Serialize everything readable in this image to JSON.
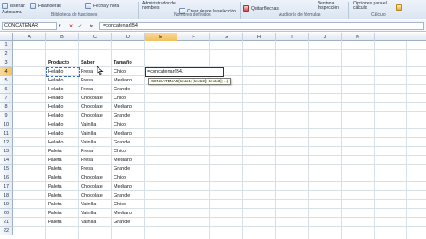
{
  "ribbon": {
    "items": [
      {
        "label": "Insertar",
        "icon": "insert-function-icon"
      },
      {
        "label": "Autosuma",
        "icon": "autosum-icon"
      },
      {
        "label": "Financieras",
        "icon": "financial-icon"
      },
      {
        "label": "Fecha y hora",
        "icon": "date-time-icon"
      },
      {
        "label": "Administrador de nombres",
        "icon": "name-manager-icon"
      },
      {
        "label": "Crear desde la selección",
        "icon": "create-from-selection-icon"
      },
      {
        "label": "Quitar flechas",
        "icon": "remove-arrows-icon"
      },
      {
        "label": "Ventana Inspección",
        "icon": "watch-window-icon"
      },
      {
        "label": "Opciones para el cálculo",
        "icon": "calc-options-icon"
      }
    ],
    "groups": [
      "Biblioteca de funciones",
      "Nombres definidos",
      "Auditoría de fórmulas",
      "Cálculo"
    ]
  },
  "formula_bar": {
    "name_box": "CONCATENAR",
    "cancel": "✕",
    "enter": "✓",
    "fx": "fx",
    "formula": "=concatenar(B4,"
  },
  "columns": [
    "A",
    "B",
    "C",
    "D",
    "E",
    "F",
    "G",
    "H",
    "I",
    "J",
    "K"
  ],
  "rows": [
    "1",
    "2",
    "3",
    "4",
    "5",
    "6",
    "7",
    "8",
    "9",
    "10",
    "11",
    "12",
    "13",
    "14",
    "15",
    "16",
    "17",
    "18",
    "19",
    "20",
    "21",
    "22"
  ],
  "active_cell": "E4",
  "table": {
    "headers": [
      "Producto",
      "Sabor",
      "Tamaño"
    ],
    "rows": [
      [
        "Helado",
        "Fresa",
        "Chico"
      ],
      [
        "Helado",
        "Fresa",
        "Mediano"
      ],
      [
        "Helado",
        "Fresa",
        "Grande"
      ],
      [
        "Helado",
        "Chocolate",
        "Chico"
      ],
      [
        "Helado",
        "Chocolate",
        "Mediano"
      ],
      [
        "Helado",
        "Chocolate",
        "Grande"
      ],
      [
        "Helado",
        "Vainilla",
        "Chico"
      ],
      [
        "Helado",
        "Vainilla",
        "Mediano"
      ],
      [
        "Helado",
        "Vainilla",
        "Grande"
      ],
      [
        "Paleta",
        "Fresa",
        "Chico"
      ],
      [
        "Paleta",
        "Fresa",
        "Mediano"
      ],
      [
        "Paleta",
        "Fresa",
        "Grande"
      ],
      [
        "Paleta",
        "Chocolate",
        "Chico"
      ],
      [
        "Paleta",
        "Chocolate",
        "Mediano"
      ],
      [
        "Paleta",
        "Chocolate",
        "Grande"
      ],
      [
        "Paleta",
        "Vainilla",
        "Chico"
      ],
      [
        "Paleta",
        "Vainilla",
        "Mediano"
      ],
      [
        "Paleta",
        "Vainilla",
        "Grande"
      ]
    ]
  },
  "editing": {
    "cell_text": "=concatenar(B4,",
    "tooltip": "CONCATENAR(texto1; [texto2]; [texto3]; ...)"
  },
  "colors": {
    "active_header": "#f1c15f",
    "grid_line": "#d9dfe7",
    "ribbon": "#dbe5f1"
  }
}
